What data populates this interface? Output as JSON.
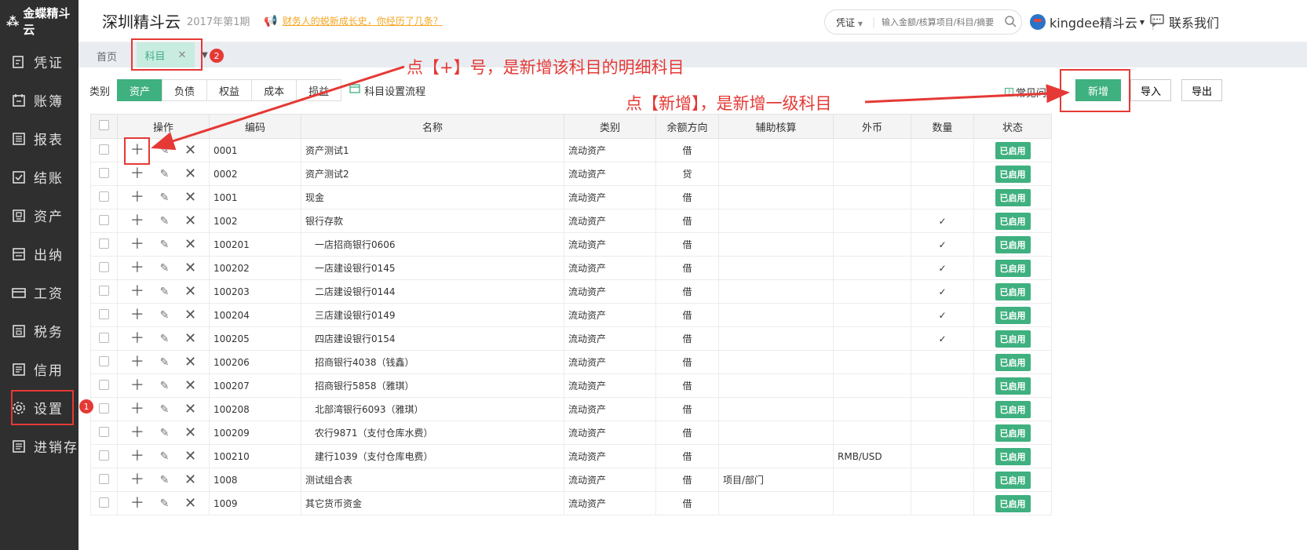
{
  "sidebar": {
    "logo": "金蝶精斗云",
    "items": [
      {
        "label": "凭证",
        "icon": "voucher-icon"
      },
      {
        "label": "账簿",
        "icon": "ledger-icon"
      },
      {
        "label": "报表",
        "icon": "report-icon"
      },
      {
        "label": "结账",
        "icon": "checkout-icon"
      },
      {
        "label": "资产",
        "icon": "asset-icon"
      },
      {
        "label": "出纳",
        "icon": "cashier-icon"
      },
      {
        "label": "工资",
        "icon": "salary-icon"
      },
      {
        "label": "税务",
        "icon": "tax-icon"
      },
      {
        "label": "信用",
        "icon": "credit-icon"
      },
      {
        "label": "设置",
        "icon": "gear-icon"
      },
      {
        "label": "进销存",
        "icon": "inventory-icon"
      }
    ],
    "settings_badge": "1"
  },
  "header": {
    "company": "深圳精斗云",
    "period": "2017年第1期",
    "notice": "财务人的蜕新成长史，你经历了几条？",
    "search_select": "凭证",
    "search_placeholder": "输入金额/核算项目/科目/摘要",
    "user": "kingdee精斗云",
    "contact": "联系我们"
  },
  "tabs": {
    "home": "首页",
    "current": "科目",
    "badge": "2"
  },
  "toolbar": {
    "category_label": "类别",
    "categories": [
      "资产",
      "负债",
      "权益",
      "成本",
      "损益"
    ],
    "active_category": "资产",
    "flow_link": "科目设置流程",
    "faq": "常见问题",
    "add": "新增",
    "import": "导入",
    "export": "导出"
  },
  "annotations": {
    "plus_hint": "点【+】号，是新增该科目的明细科目",
    "add_hint": "点【新增】，是新增一级科目"
  },
  "table": {
    "headers": {
      "ops": "操作",
      "code": "编码",
      "name": "名称",
      "type": "类别",
      "direction": "余额方向",
      "aux": "辅助核算",
      "currency": "外币",
      "quantity": "数量",
      "status": "状态"
    },
    "rows": [
      {
        "code": "0001",
        "name": "资产测试1",
        "type": "流动资产",
        "direction": "借",
        "aux": "",
        "currency": "",
        "qty": "",
        "status": "已启用"
      },
      {
        "code": "0002",
        "name": "资产测试2",
        "type": "流动资产",
        "direction": "贷",
        "aux": "",
        "currency": "",
        "qty": "",
        "status": "已启用"
      },
      {
        "code": "1001",
        "name": "现金",
        "type": "流动资产",
        "direction": "借",
        "aux": "",
        "currency": "",
        "qty": "",
        "status": "已启用"
      },
      {
        "code": "1002",
        "name": "银行存款",
        "type": "流动资产",
        "direction": "借",
        "aux": "",
        "currency": "",
        "qty": "✓",
        "status": "已启用"
      },
      {
        "code": "100201",
        "name": "一店招商银行0606",
        "type": "流动资产",
        "direction": "借",
        "aux": "",
        "currency": "",
        "qty": "✓",
        "status": "已启用"
      },
      {
        "code": "100202",
        "name": "一店建设银行0145",
        "type": "流动资产",
        "direction": "借",
        "aux": "",
        "currency": "",
        "qty": "✓",
        "status": "已启用"
      },
      {
        "code": "100203",
        "name": "二店建设银行0144",
        "type": "流动资产",
        "direction": "借",
        "aux": "",
        "currency": "",
        "qty": "✓",
        "status": "已启用"
      },
      {
        "code": "100204",
        "name": "三店建设银行0149",
        "type": "流动资产",
        "direction": "借",
        "aux": "",
        "currency": "",
        "qty": "✓",
        "status": "已启用"
      },
      {
        "code": "100205",
        "name": "四店建设银行0154",
        "type": "流动资产",
        "direction": "借",
        "aux": "",
        "currency": "",
        "qty": "✓",
        "status": "已启用"
      },
      {
        "code": "100206",
        "name": "招商银行4038（钱鑫）",
        "type": "流动资产",
        "direction": "借",
        "aux": "",
        "currency": "",
        "qty": "",
        "status": "已启用"
      },
      {
        "code": "100207",
        "name": "招商银行5858（雅琪）",
        "type": "流动资产",
        "direction": "借",
        "aux": "",
        "currency": "",
        "qty": "",
        "status": "已启用"
      },
      {
        "code": "100208",
        "name": "北部湾银行6093（雅琪）",
        "type": "流动资产",
        "direction": "借",
        "aux": "",
        "currency": "",
        "qty": "",
        "status": "已启用"
      },
      {
        "code": "100209",
        "name": "农行9871（支付仓库水费）",
        "type": "流动资产",
        "direction": "借",
        "aux": "",
        "currency": "",
        "qty": "",
        "status": "已启用"
      },
      {
        "code": "100210",
        "name": "建行1039（支付仓库电费）",
        "type": "流动资产",
        "direction": "借",
        "aux": "",
        "currency": "RMB/USD",
        "qty": "",
        "status": "已启用"
      },
      {
        "code": "1008",
        "name": "测试组合表",
        "type": "流动资产",
        "direction": "借",
        "aux": "项目/部门",
        "currency": "",
        "qty": "",
        "status": "已启用"
      },
      {
        "code": "1009",
        "name": "其它货币资金",
        "type": "流动资产",
        "direction": "借",
        "aux": "",
        "currency": "",
        "qty": "",
        "status": "已启用"
      }
    ]
  },
  "colors": {
    "accent": "#3fb07f",
    "sidebar_bg": "#2f2f2f",
    "annotation": "#e53935"
  }
}
